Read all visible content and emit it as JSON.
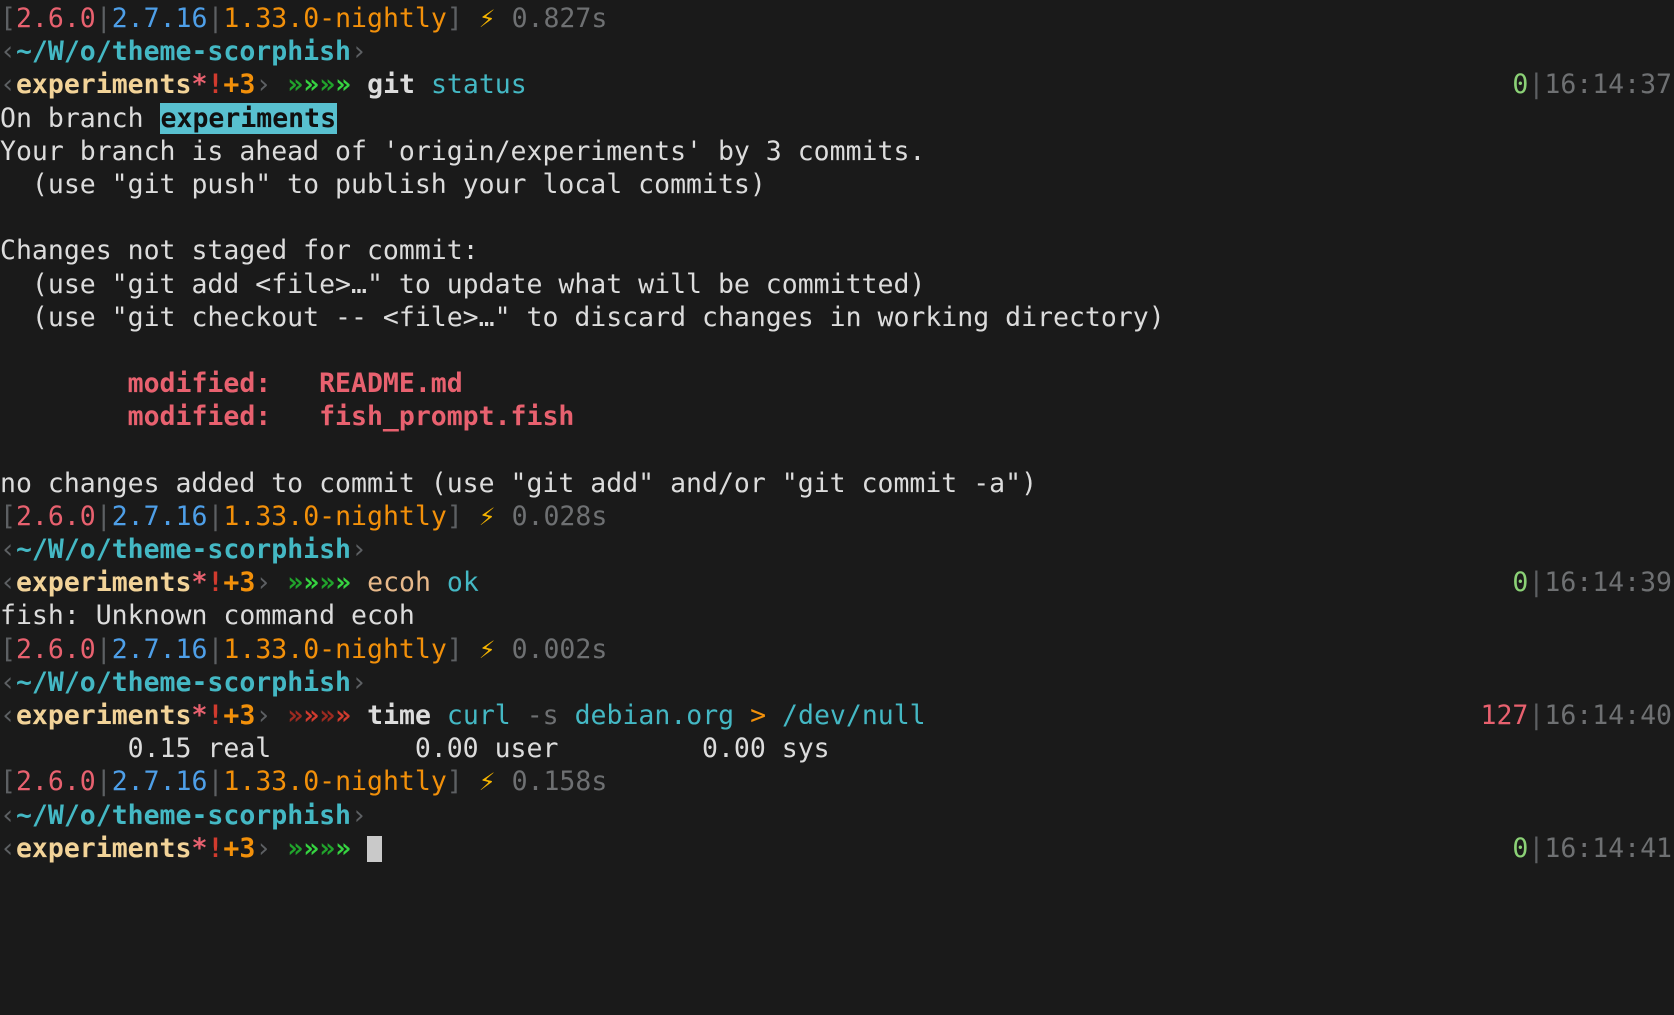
{
  "terminal": {
    "shell": "fish",
    "background_color": "#1a1a1a",
    "foreground_color": "#d8d8d8",
    "theme_name": "scorphish"
  },
  "prompt": {
    "versions": {
      "open_bracket": "[",
      "ruby": "2.6.0",
      "sep1": "|",
      "python": "2.7.16",
      "sep2": "|",
      "rust": "1.33.0-nightly",
      "close_bracket": "]"
    },
    "bolt_icon": "⚡",
    "path_open": "‹",
    "path": "~/W/o/theme-scorphish",
    "path_close": "›",
    "git_open": "‹",
    "git_branch": "experiments",
    "git_dirty": "*",
    "git_bang": "!",
    "git_ahead": "+3",
    "git_close": "›",
    "chevrons": "»»»»"
  },
  "blocks": [
    {
      "duration": "0.827s",
      "exit_code": "0",
      "timestamp": "16:14:37",
      "status_sep": "|",
      "chevron_state": "ok",
      "command_parts": [
        {
          "text": "git",
          "style": "cmd"
        },
        {
          "text": " ",
          "style": "plain"
        },
        {
          "text": "status",
          "style": "arg"
        }
      ],
      "output": [
        [
          {
            "text": "On branch ",
            "style": "white"
          },
          {
            "text": "experiments",
            "style": "branch-hl"
          }
        ],
        [
          {
            "text": "Your branch is ahead of 'origin/experiments' by 3 commits.",
            "style": "white"
          }
        ],
        [
          {
            "text": "  (use \"git push\" to publish your local commits)",
            "style": "white"
          }
        ],
        [
          {
            "text": "",
            "style": "white"
          }
        ],
        [
          {
            "text": "Changes not staged for commit:",
            "style": "white"
          }
        ],
        [
          {
            "text": "  (use \"git add <file>…\" to update what will be committed)",
            "style": "white"
          }
        ],
        [
          {
            "text": "  (use \"git checkout -- <file>…\" to discard changes in working directory)",
            "style": "white"
          }
        ],
        [
          {
            "text": "",
            "style": "white"
          }
        ],
        [
          {
            "text": "        modified:   README.md",
            "style": "modified"
          }
        ],
        [
          {
            "text": "        modified:   fish_prompt.fish",
            "style": "modified"
          }
        ],
        [
          {
            "text": "",
            "style": "white"
          }
        ],
        [
          {
            "text": "no changes added to commit (use \"git add\" and/or \"git commit -a\")",
            "style": "white"
          }
        ]
      ]
    },
    {
      "duration": "0.028s",
      "exit_code": "0",
      "timestamp": "16:14:39",
      "status_sep": "|",
      "chevron_state": "ok",
      "command_parts": [
        {
          "text": "ecoh",
          "style": "badcmd"
        },
        {
          "text": " ",
          "style": "plain"
        },
        {
          "text": "ok",
          "style": "arg"
        }
      ],
      "output": [
        [
          {
            "text": "fish: Unknown command ecoh",
            "style": "white"
          }
        ]
      ]
    },
    {
      "duration": "0.002s",
      "exit_code": "127",
      "timestamp": "16:14:40",
      "status_sep": "|",
      "chevron_state": "error",
      "command_parts": [
        {
          "text": "time",
          "style": "cmd"
        },
        {
          "text": " ",
          "style": "plain"
        },
        {
          "text": "curl",
          "style": "arg"
        },
        {
          "text": " ",
          "style": "plain"
        },
        {
          "text": "-s",
          "style": "flag"
        },
        {
          "text": " ",
          "style": "plain"
        },
        {
          "text": "debian.org",
          "style": "arg"
        },
        {
          "text": " ",
          "style": "plain"
        },
        {
          "text": ">",
          "style": "redir"
        },
        {
          "text": " ",
          "style": "plain"
        },
        {
          "text": "/dev/null",
          "style": "arg"
        }
      ],
      "output": [
        [
          {
            "text": "        0.15 real         0.00 user         0.00 sys",
            "style": "white"
          }
        ]
      ]
    },
    {
      "duration": "0.158s",
      "exit_code": "0",
      "timestamp": "16:14:41",
      "status_sep": "|",
      "chevron_state": "ok",
      "command_parts": [],
      "output": [],
      "cursor": true
    }
  ]
}
